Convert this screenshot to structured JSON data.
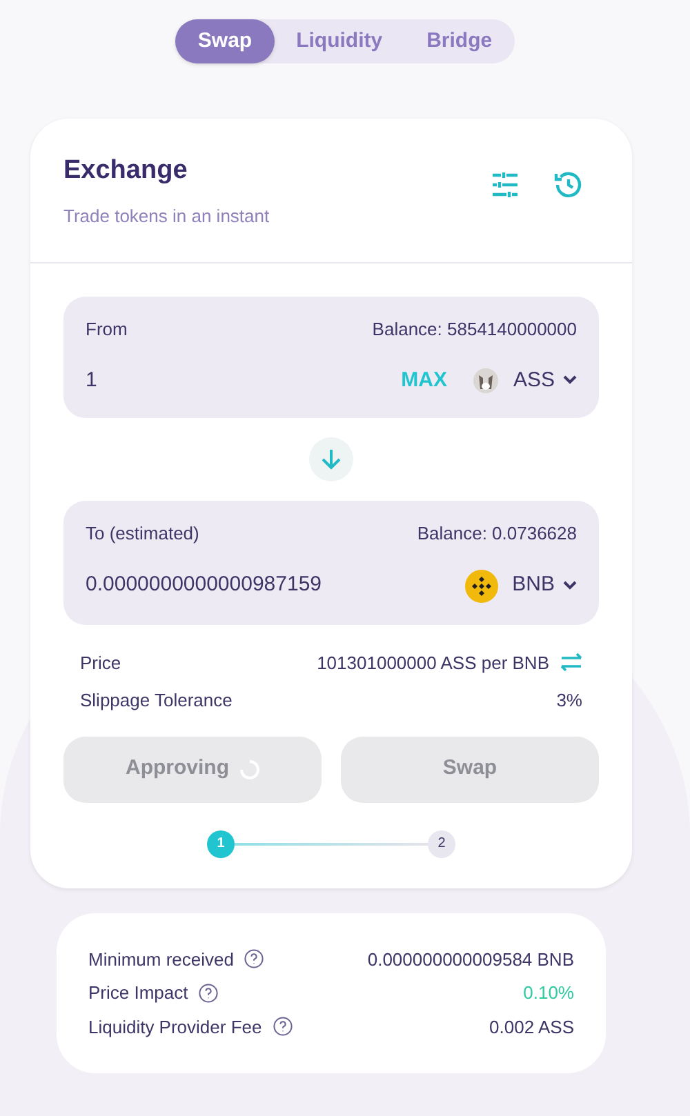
{
  "tabs": [
    {
      "label": "Swap",
      "selected": true
    },
    {
      "label": "Liquidity",
      "selected": false
    },
    {
      "label": "Bridge",
      "selected": false
    }
  ],
  "exchange": {
    "title": "Exchange",
    "subtitle": "Trade tokens in an instant",
    "from": {
      "label": "From",
      "balance": "Balance: 5854140000000",
      "amount": "1",
      "max": "MAX",
      "token": "ASS"
    },
    "to": {
      "label": "To (estimated)",
      "balance": "Balance: 0.0736628",
      "amount": "0.0000000000000987159",
      "token": "BNB"
    },
    "price": {
      "label": "Price",
      "value": "101301000000 ASS per BNB"
    },
    "slippage": {
      "label": "Slippage Tolerance",
      "value": "3%"
    },
    "buttons": [
      {
        "label": "Approving",
        "disabled": true,
        "loading": true
      },
      {
        "label": "Swap",
        "disabled": true,
        "loading": false
      }
    ],
    "steps": [
      {
        "label": "1",
        "active": true
      },
      {
        "label": "2",
        "active": false
      }
    ]
  },
  "details": [
    {
      "label": "Minimum received",
      "value": "0.000000000009584 BNB",
      "color": "#3d3565"
    },
    {
      "label": "Price Impact",
      "value": "0.10%",
      "color": "#31c9a0"
    },
    {
      "label": "Liquidity Provider Fee",
      "value": "0.002 ASS",
      "color": "#3d3565"
    }
  ]
}
